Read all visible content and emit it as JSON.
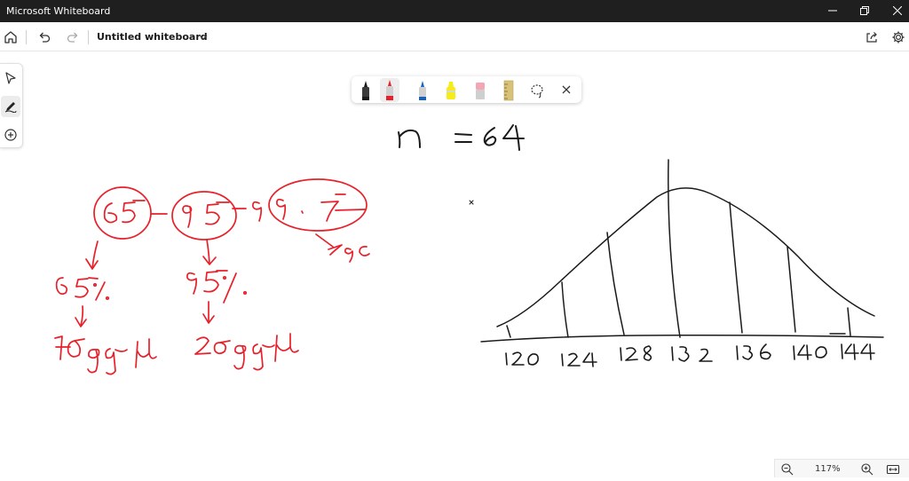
{
  "window": {
    "title": "Microsoft Whiteboard"
  },
  "app_bar": {
    "doc_title": "Untitled whiteboard"
  },
  "pen_tray": {
    "pens": [
      {
        "name": "black",
        "color": "#1a1a1a"
      },
      {
        "name": "red",
        "color": "#e8202a",
        "selected": true
      },
      {
        "name": "blue",
        "color": "#1565c0"
      },
      {
        "name": "yellow-highlighter",
        "color": "#f5ec18"
      },
      {
        "name": "pink-eraser",
        "color": "#f4a6b4"
      },
      {
        "name": "ruler",
        "color": "#d8c27a"
      }
    ]
  },
  "ink_color": "#e8202a",
  "zoom": {
    "level": "117%"
  },
  "drawing": {
    "n_label": "n = 64",
    "circled": [
      "65",
      "95",
      "99.7"
    ],
    "extra_note": "> 9c",
    "under_labels": [
      "65%",
      "95%"
    ],
    "bottom_notes": [
      "1σ of μ",
      "2σ of μ"
    ],
    "axis_ticks": [
      "120",
      "124",
      "128",
      "132",
      "136",
      "140",
      "144"
    ]
  }
}
